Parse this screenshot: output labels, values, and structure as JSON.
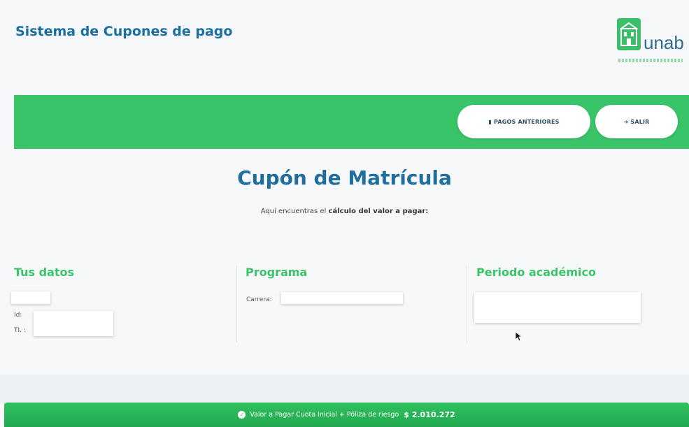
{
  "header": {
    "title": "Sistema de Cupones de pago",
    "logo_text": "unab"
  },
  "nav": {
    "pagos_label": "PAGOS ANTERIORES",
    "salir_label": "SALIR"
  },
  "main": {
    "title": "Cupón de Matrícula",
    "subtitle_prefix": "Aquí encuentras el",
    "subtitle_bold": "cálculo del valor a pagar:"
  },
  "datos": {
    "heading": "Tus datos",
    "id_label": "Id:",
    "ti_label": "TI. :"
  },
  "programa": {
    "heading": "Programa",
    "carrera_label": "Carrera:"
  },
  "periodo": {
    "heading": "Periodo académico"
  },
  "footer": {
    "label": "Valor a Pagar Cuota Inicial + Póliza de riesgo",
    "amount": "$ 2.010.272"
  },
  "colors": {
    "accent_green": "#39c468",
    "title_blue": "#1f6e9d"
  },
  "icons": {
    "pagos": "document-icon",
    "salir": "logout-icon",
    "footer": "check-circle-icon"
  }
}
